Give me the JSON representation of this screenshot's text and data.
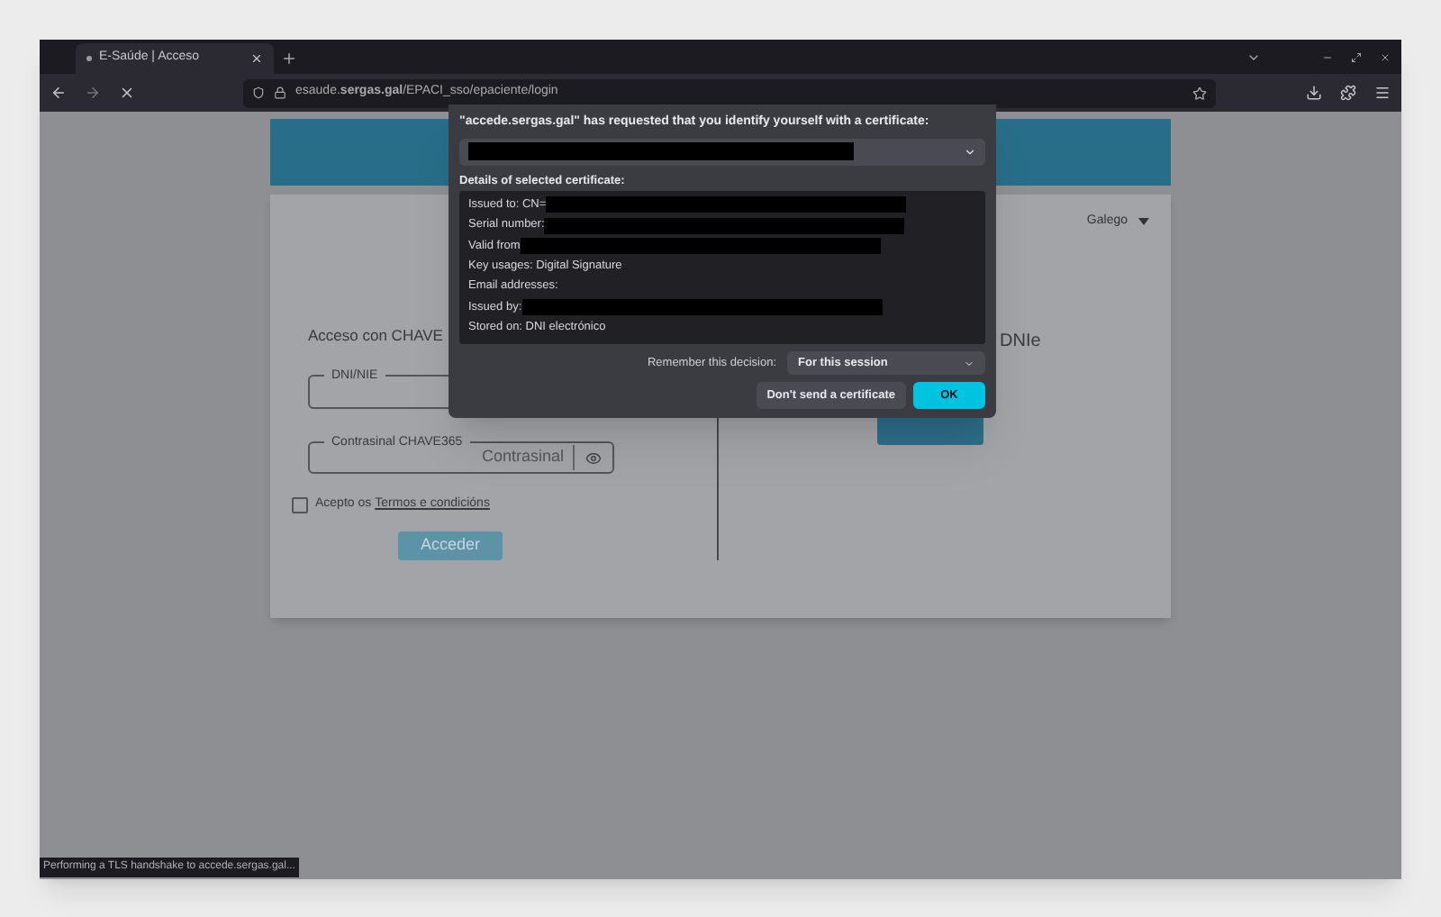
{
  "browser": {
    "tabs": [
      {
        "title": "E-Saúde | Acceso",
        "selected": true
      }
    ],
    "url": "esaude.**sergas.gal**/EPACI_sso/epaciente/login",
    "status": "Performing a TLS handshake to accede.sergas.gal..."
  },
  "page": {
    "language": "Galego",
    "left": {
      "heading": "Acceso con CHAVE",
      "dni_label": "DNI/NIE",
      "password_label": "Contrasinal CHAVE365",
      "password_placeholder": "Contrasinal",
      "terms": {
        "checked": false,
        "text": "Acepto os",
        "link": "Termos e condicións"
      },
      "button": "Acceder"
    },
    "right": {
      "heading": "DNIe"
    }
  },
  "dialog": {
    "title": "\"accede.sergas.gal\" has requested that you identify yourself with a certificate:",
    "details_label": "Details of selected certificate:",
    "details": [
      {
        "label": "Issued to: CN=",
        "redacted": true
      },
      {
        "label": "Serial number:",
        "redacted": true
      },
      {
        "label": "Valid from",
        "redacted": true
      },
      {
        "label": "Key usages: Digital Signature",
        "redacted": false
      },
      {
        "label": "Email addresses:",
        "redacted": false
      },
      {
        "label": "Issued by:",
        "redacted": true
      },
      {
        "label": "Stored on: DNI electrónico",
        "redacted": false
      }
    ],
    "remember_label": "Remember this decision:",
    "remember_value": "For this session",
    "buttons": [
      {
        "label": "Don't send a certificate",
        "kind": "secondary"
      },
      {
        "label": "OK",
        "kind": "primary"
      }
    ]
  }
}
